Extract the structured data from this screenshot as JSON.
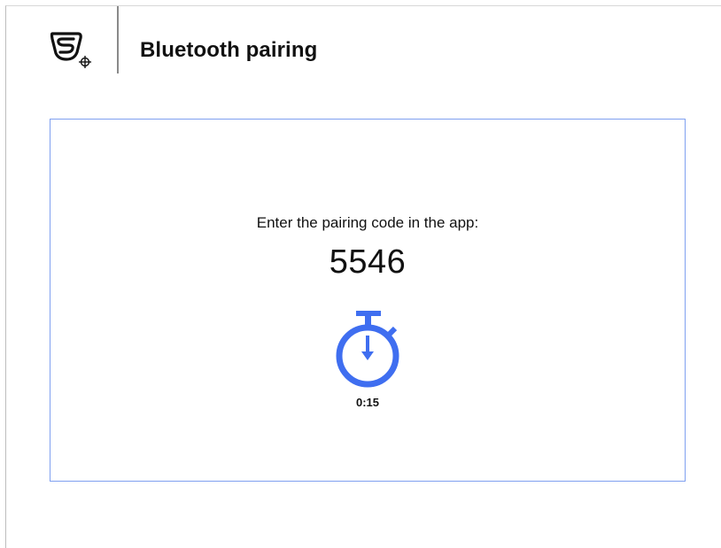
{
  "header": {
    "logo_icon": "brand-logo-icon",
    "title": "Bluetooth pairing"
  },
  "pairing": {
    "instruction": "Enter the pairing code in the app:",
    "code": "5546",
    "timer_icon": "stopwatch-icon",
    "countdown": "0:15"
  },
  "colors": {
    "accent": "#3f6ef0",
    "panel_border": "#7fa0f0",
    "text": "#111111"
  }
}
